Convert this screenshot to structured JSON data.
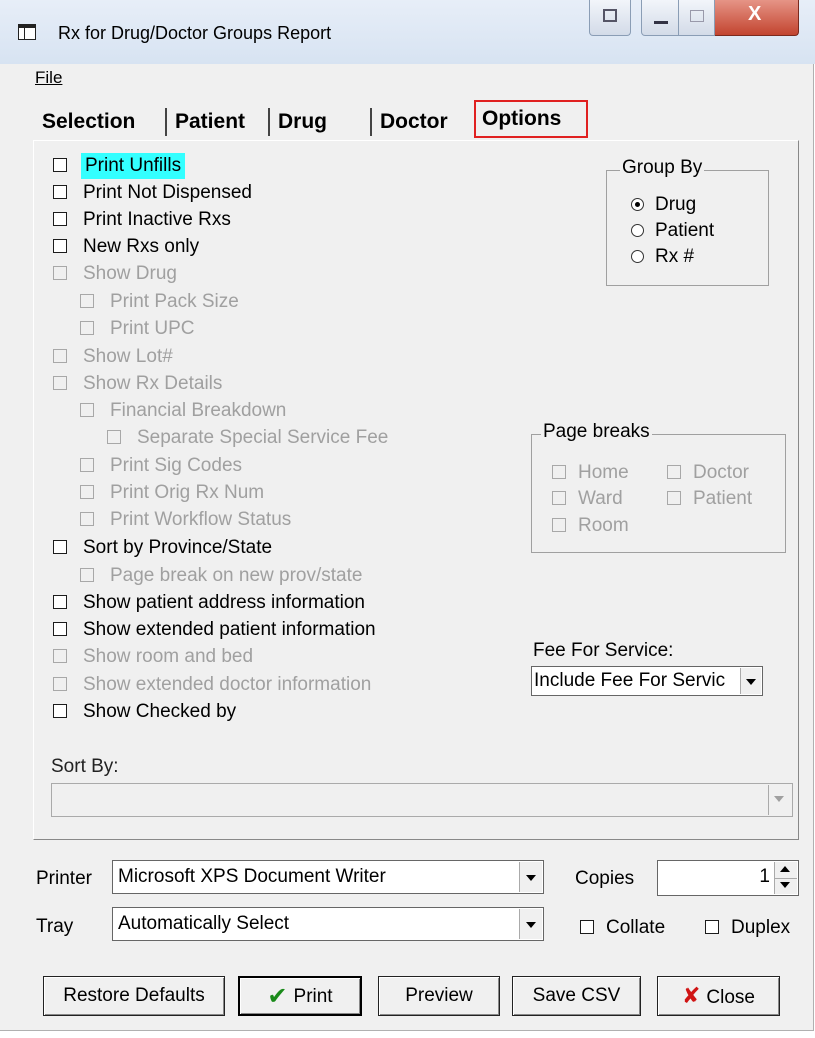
{
  "window": {
    "title": "Rx for Drug/Doctor Groups Report",
    "close_glyph": "X"
  },
  "menu": {
    "file": "File"
  },
  "tabs": [
    {
      "label": "Selection"
    },
    {
      "label": "Patient"
    },
    {
      "label": "Drug"
    },
    {
      "label": "Doctor"
    },
    {
      "label": "Options",
      "active": true
    }
  ],
  "options": [
    {
      "label": "Print Unfills",
      "checked": false,
      "enabled": true,
      "focused": true
    },
    {
      "label": "Print Not Dispensed",
      "checked": false,
      "enabled": true
    },
    {
      "label": "Print Inactive Rxs",
      "checked": false,
      "enabled": true
    },
    {
      "label": "New Rxs only",
      "checked": false,
      "enabled": true
    },
    {
      "label": "Show Drug",
      "checked": false,
      "enabled": false
    },
    {
      "label": "Print Pack Size",
      "checked": false,
      "enabled": false
    },
    {
      "label": "Print UPC",
      "checked": false,
      "enabled": false
    },
    {
      "label": "Show Lot#",
      "checked": false,
      "enabled": false
    },
    {
      "label": "Show Rx Details",
      "checked": false,
      "enabled": false
    },
    {
      "label": "Financial Breakdown",
      "checked": false,
      "enabled": false
    },
    {
      "label": "Separate Special Service Fee",
      "checked": false,
      "enabled": false
    },
    {
      "label": "Print Sig Codes",
      "checked": false,
      "enabled": false
    },
    {
      "label": "Print Orig Rx Num",
      "checked": false,
      "enabled": false
    },
    {
      "label": "Print Workflow Status",
      "checked": false,
      "enabled": false
    },
    {
      "label": "Sort by Province/State",
      "checked": false,
      "enabled": true
    },
    {
      "label": "Page break on new prov/state",
      "checked": false,
      "enabled": false
    },
    {
      "label": "Show patient address information",
      "checked": false,
      "enabled": true
    },
    {
      "label": "Show extended patient information",
      "checked": false,
      "enabled": true
    },
    {
      "label": "Show room and bed",
      "checked": false,
      "enabled": false
    },
    {
      "label": "Show extended doctor information",
      "checked": false,
      "enabled": false
    },
    {
      "label": "Show Checked by",
      "checked": false,
      "enabled": true
    }
  ],
  "group_by": {
    "legend": "Group By",
    "options": [
      "Drug",
      "Patient",
      "Rx #"
    ],
    "selected": "Drug"
  },
  "page_breaks": {
    "legend": "Page breaks",
    "options": [
      "Home",
      "Doctor",
      "Ward",
      "Patient",
      "Room"
    ]
  },
  "fee_for_service": {
    "label": "Fee For Service:",
    "value": "Include Fee For Servic"
  },
  "sort_by": {
    "label": "Sort By:",
    "value": ""
  },
  "printer": {
    "label": "Printer",
    "value": "Microsoft XPS Document Writer",
    "tray_label": "Tray",
    "tray_value": "Automatically Select",
    "copies_label": "Copies",
    "copies_value": "1",
    "collate_label": "Collate",
    "duplex_label": "Duplex"
  },
  "buttons": {
    "restore": "Restore Defaults",
    "print": "Print",
    "preview": "Preview",
    "save_csv": "Save CSV",
    "close": "Close"
  }
}
